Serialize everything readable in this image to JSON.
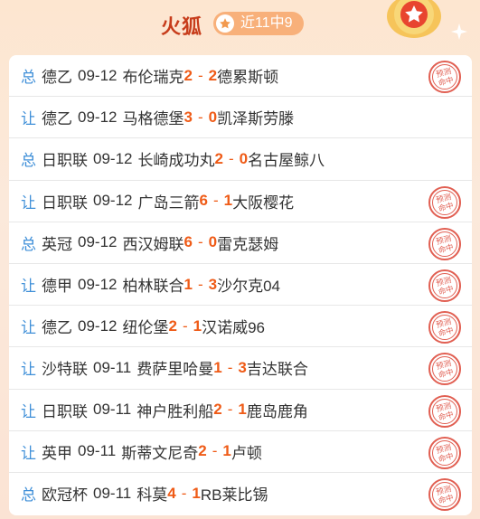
{
  "header": {
    "title": "火狐",
    "badge": "近11中9"
  },
  "stamp_text": "预测命中",
  "colors": {
    "accent": "#ef5b17",
    "tag": "#3f8fd8",
    "title": "#c73c1b",
    "stamp": "#e15f52"
  },
  "matches": [
    {
      "tag": "总",
      "league": "德乙",
      "date": "09-12",
      "home": "布伦瑞克",
      "hs": "2",
      "as": "2",
      "away": "德累斯顿",
      "hit": true
    },
    {
      "tag": "让",
      "league": "德乙",
      "date": "09-12",
      "home": "马格德堡",
      "hs": "3",
      "as": "0",
      "away": "凯泽斯劳滕",
      "hit": false
    },
    {
      "tag": "总",
      "league": "日职联",
      "date": "09-12",
      "home": "长崎成功丸",
      "hs": "2",
      "as": "0",
      "away": "名古屋鲸八",
      "hit": false
    },
    {
      "tag": "让",
      "league": "日职联",
      "date": "09-12",
      "home": "广岛三箭",
      "hs": "6",
      "as": "1",
      "away": "大阪樱花",
      "hit": true
    },
    {
      "tag": "总",
      "league": "英冠",
      "date": "09-12",
      "home": "西汉姆联",
      "hs": "6",
      "as": "0",
      "away": "雷克瑟姆",
      "hit": true
    },
    {
      "tag": "让",
      "league": "德甲",
      "date": "09-12",
      "home": "柏林联合",
      "hs": "1",
      "as": "3",
      "away": "沙尔克04",
      "hit": true
    },
    {
      "tag": "让",
      "league": "德乙",
      "date": "09-12",
      "home": "纽伦堡",
      "hs": "2",
      "as": "1",
      "away": "汉诺威96",
      "hit": true
    },
    {
      "tag": "让",
      "league": "沙特联",
      "date": "09-11",
      "home": "费萨里哈曼",
      "hs": "1",
      "as": "3",
      "away": "吉达联合",
      "hit": true
    },
    {
      "tag": "让",
      "league": "日职联",
      "date": "09-11",
      "home": "神户胜利船",
      "hs": "2",
      "as": "1",
      "away": "鹿岛鹿角",
      "hit": true
    },
    {
      "tag": "让",
      "league": "英甲",
      "date": "09-11",
      "home": "斯蒂文尼奇",
      "hs": "2",
      "as": "1",
      "away": "卢顿",
      "hit": true
    },
    {
      "tag": "总",
      "league": "欧冠杯",
      "date": "09-11",
      "home": "科莫",
      "hs": "4",
      "as": "1",
      "away": "RB莱比锡",
      "hit": true
    }
  ]
}
